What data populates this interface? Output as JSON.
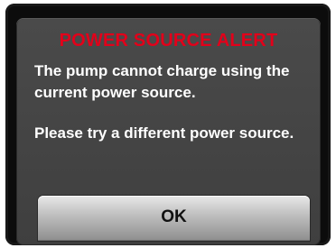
{
  "dialog": {
    "title": "POWER SOURCE ALERT",
    "message_primary": "The pump cannot charge using the current power source.",
    "message_secondary": "Please try a different power source.",
    "ok_label": "OK"
  },
  "colors": {
    "title": "#e2001a",
    "dialog_background": "#444444",
    "screen_background": "#0c0c0c",
    "text": "#ffffff",
    "button": "#c7c7c7"
  }
}
